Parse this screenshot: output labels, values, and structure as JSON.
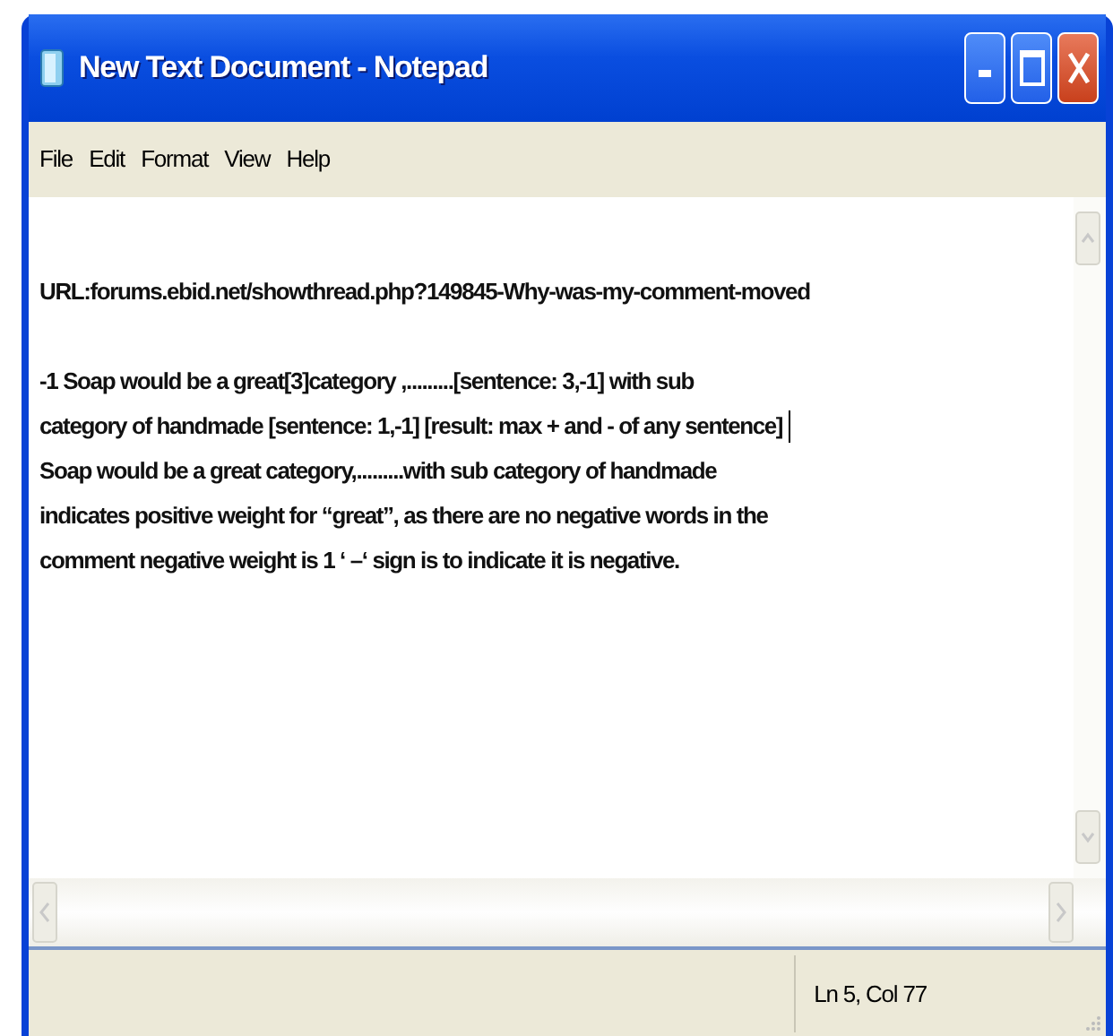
{
  "window": {
    "title": "New Text Document - Notepad"
  },
  "menu": [
    {
      "label": "File"
    },
    {
      "label": "Edit"
    },
    {
      "label": "Format"
    },
    {
      "label": "View"
    },
    {
      "label": "Help"
    }
  ],
  "document": {
    "paragraphs": [
      {
        "lines": [
          {
            "text": "URL:forums.ebid.net/showthread.php?149845-Why-was-my-comment-moved",
            "caret": false
          }
        ]
      },
      {
        "lines": [
          {
            "text": "-1 Soap would be a great[3]category ,.........[sentence: 3,-1] with sub",
            "caret": false
          },
          {
            "text": "category of handmade [sentence: 1,-1] [result: max + and - of any sentence]",
            "caret": true
          },
          {
            "text": "Soap would be a great category,.........with sub category of handmade",
            "caret": false
          },
          {
            "text": "indicates positive weight for “great”, as there are no negative words in the",
            "caret": false
          },
          {
            "text": "comment  negative weight is 1 ‘ –‘ sign is to indicate it is negative.",
            "caret": false
          }
        ]
      }
    ]
  },
  "status_bar": {
    "position": "Ln 5, Col 77"
  }
}
